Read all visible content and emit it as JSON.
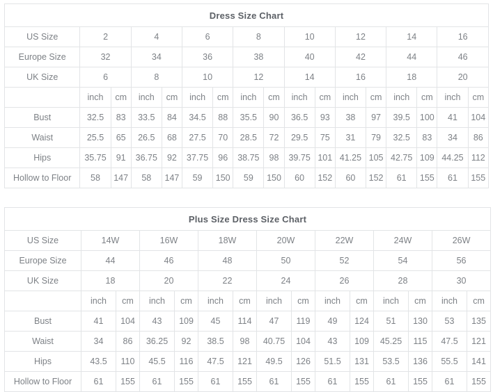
{
  "tables": [
    {
      "title": "Dress Size Chart",
      "size_rows": [
        {
          "label": "US Size",
          "values": [
            "2",
            "4",
            "6",
            "8",
            "10",
            "12",
            "14",
            "16"
          ]
        },
        {
          "label": "Europe Size",
          "values": [
            "32",
            "34",
            "36",
            "38",
            "40",
            "42",
            "44",
            "46"
          ]
        },
        {
          "label": "UK Size",
          "values": [
            "6",
            "8",
            "10",
            "12",
            "14",
            "16",
            "18",
            "20"
          ]
        }
      ],
      "unit_row": {
        "label": "",
        "units": [
          "inch",
          "cm",
          "inch",
          "cm",
          "inch",
          "cm",
          "inch",
          "cm",
          "inch",
          "cm",
          "inch",
          "cm",
          "inch",
          "cm",
          "inch",
          "cm"
        ]
      },
      "measure_rows": [
        {
          "label": "Bust",
          "values": [
            "32.5",
            "83",
            "33.5",
            "84",
            "34.5",
            "88",
            "35.5",
            "90",
            "36.5",
            "93",
            "38",
            "97",
            "39.5",
            "100",
            "41",
            "104"
          ]
        },
        {
          "label": "Waist",
          "values": [
            "25.5",
            "65",
            "26.5",
            "68",
            "27.5",
            "70",
            "28.5",
            "72",
            "29.5",
            "75",
            "31",
            "79",
            "32.5",
            "83",
            "34",
            "86"
          ]
        },
        {
          "label": "Hips",
          "values": [
            "35.75",
            "91",
            "36.75",
            "92",
            "37.75",
            "96",
            "38.75",
            "98",
            "39.75",
            "101",
            "41.25",
            "105",
            "42.75",
            "109",
            "44.25",
            "112"
          ]
        },
        {
          "label": "Hollow to Floor",
          "values": [
            "58",
            "147",
            "58",
            "147",
            "59",
            "150",
            "59",
            "150",
            "60",
            "152",
            "60",
            "152",
            "61",
            "155",
            "61",
            "155"
          ]
        }
      ]
    },
    {
      "title": "Plus Size Dress Size Chart",
      "size_rows": [
        {
          "label": "US Size",
          "values": [
            "14W",
            "16W",
            "18W",
            "20W",
            "22W",
            "24W",
            "26W"
          ]
        },
        {
          "label": "Europe Size",
          "values": [
            "44",
            "46",
            "48",
            "50",
            "52",
            "54",
            "56"
          ]
        },
        {
          "label": "UK Size",
          "values": [
            "18",
            "20",
            "22",
            "24",
            "26",
            "28",
            "30"
          ]
        }
      ],
      "unit_row": {
        "label": "",
        "units": [
          "inch",
          "cm",
          "inch",
          "cm",
          "inch",
          "cm",
          "inch",
          "cm",
          "inch",
          "cm",
          "inch",
          "cm",
          "inch",
          "cm"
        ]
      },
      "measure_rows": [
        {
          "label": "Bust",
          "values": [
            "41",
            "104",
            "43",
            "109",
            "45",
            "114",
            "47",
            "119",
            "49",
            "124",
            "51",
            "130",
            "53",
            "135"
          ]
        },
        {
          "label": "Waist",
          "values": [
            "34",
            "86",
            "36.25",
            "92",
            "38.5",
            "98",
            "40.75",
            "104",
            "43",
            "109",
            "45.25",
            "115",
            "47.5",
            "121"
          ]
        },
        {
          "label": "Hips",
          "values": [
            "43.5",
            "110",
            "45.5",
            "116",
            "47.5",
            "121",
            "49.5",
            "126",
            "51.5",
            "131",
            "53.5",
            "136",
            "55.5",
            "141"
          ]
        },
        {
          "label": "Hollow to Floor",
          "values": [
            "61",
            "155",
            "61",
            "155",
            "61",
            "155",
            "61",
            "155",
            "61",
            "155",
            "61",
            "155",
            "61",
            "155"
          ]
        }
      ]
    }
  ],
  "colors": {
    "border": "#e2e4e6",
    "text": "#7d8186",
    "title_text": "#5c6066",
    "background": "#ffffff"
  }
}
